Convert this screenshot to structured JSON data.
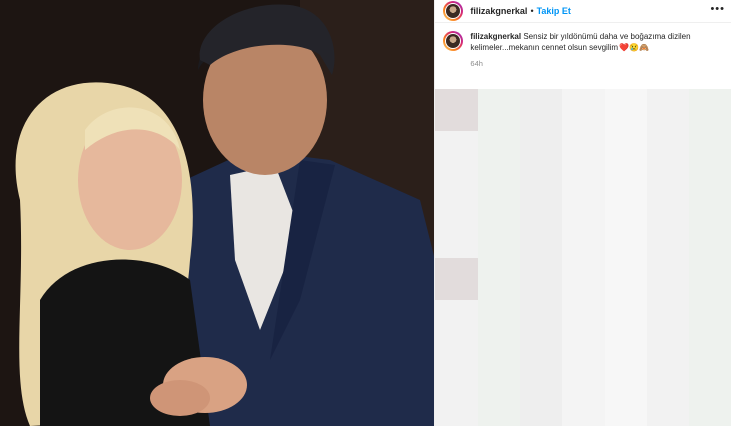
{
  "post": {
    "username": "filizakgnerkal",
    "follow_label": "Takip Et",
    "separator": "•",
    "more_label": "•••"
  },
  "caption": {
    "username": "filizakgnerkal",
    "text": "Sensiz bir yıldönümü daha ve boğazıma dizilen kelimeler...mekanın cennet olsun sevgilim",
    "emojis": "❤️😢🙈",
    "time": "64h"
  },
  "colors": {
    "accent": "#0095f6",
    "text": "#262626",
    "muted": "#8e8e8e",
    "border": "#efefef"
  }
}
